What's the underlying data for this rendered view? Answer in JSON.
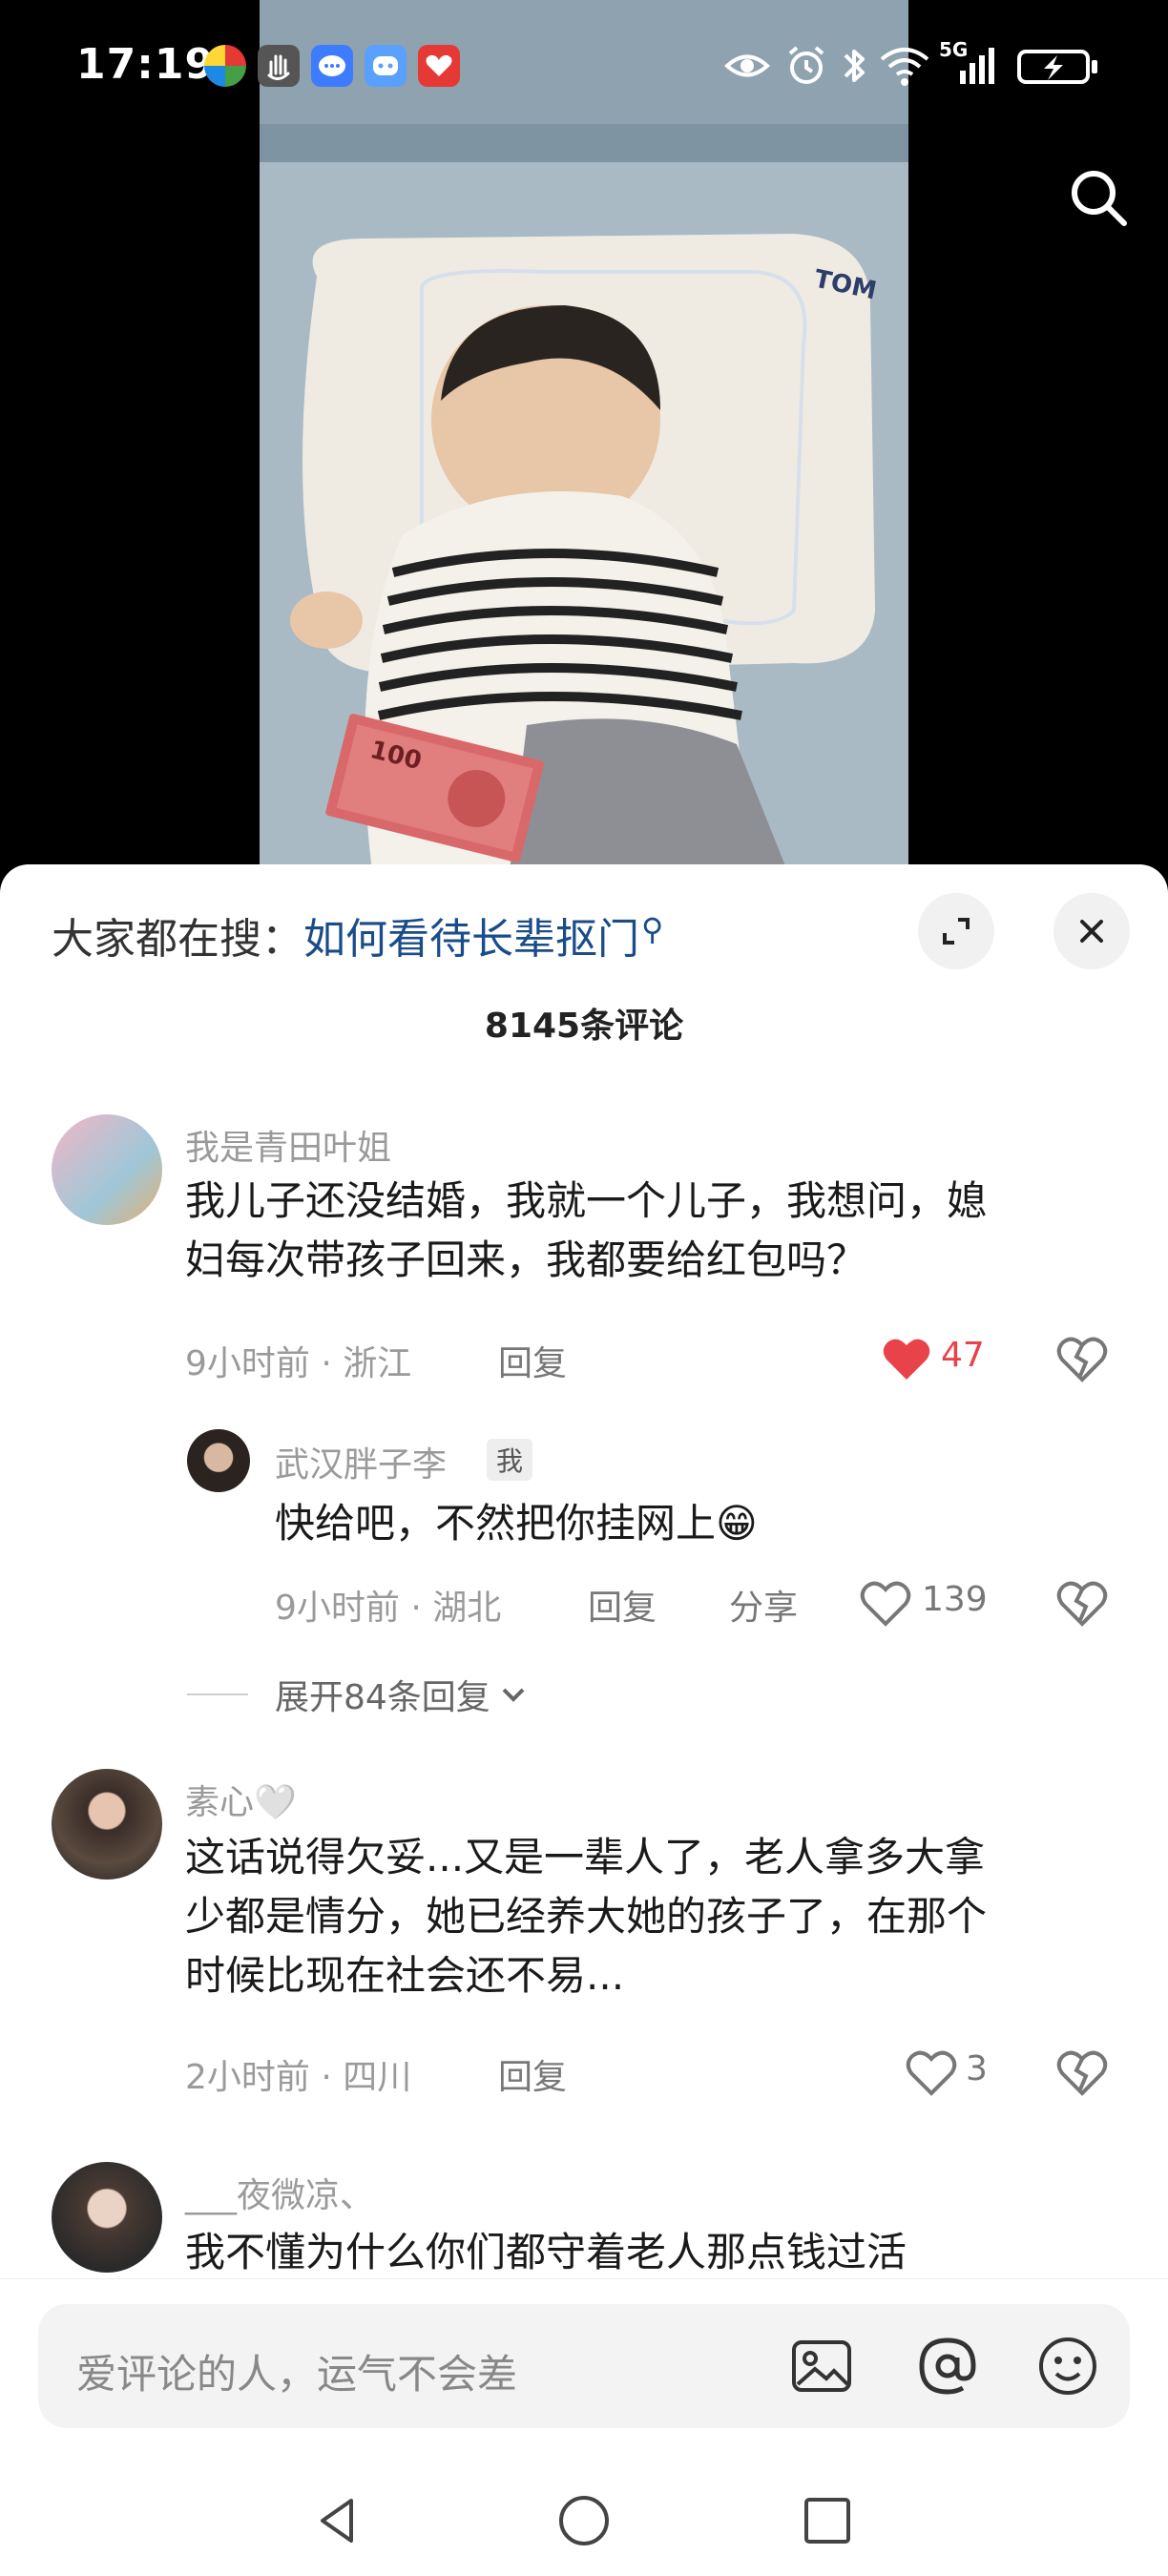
{
  "status_bar": {
    "time": "17:19",
    "network": "5G",
    "icons": [
      "eye-icon",
      "alarm-icon",
      "bluetooth-icon",
      "wifi-icon",
      "signal-icon",
      "battery-charging-icon"
    ]
  },
  "video": {
    "pillow_brand": "TOM",
    "banknote_value": "100"
  },
  "sheet": {
    "search_prefix": "大家都在搜：",
    "search_query": "如何看待长辈抠门",
    "comment_count": "8145条评论"
  },
  "comments": [
    {
      "username": "我是青田叶姐",
      "text_line1": "我儿子还没结婚，我就一个儿子，我想问，媳",
      "text_line2": "妇每次带孩子回来，我都要给红包吗？",
      "meta": "9小时前 · 浙江",
      "reply_label": "回复",
      "likes": "47",
      "liked": true,
      "reply": {
        "username": "武汉胖子李",
        "badge": "我",
        "text": "快给吧，不然把你挂网上😁",
        "meta": "9小时前 · 湖北",
        "reply_label": "回复",
        "share_label": "分享",
        "likes": "139"
      },
      "expand_label": "展开84条回复"
    },
    {
      "username": "素心🤍",
      "text_line1": "这话说得欠妥...又是一辈人了，老人拿多大拿",
      "text_line2": "少都是情分，她已经养大她的孩子了，在那个",
      "text_line3": "时候比现在社会还不易...",
      "meta": "2小时前 · 四川",
      "reply_label": "回复",
      "likes": "3"
    },
    {
      "username": "___夜微凉、",
      "text_line1": "我不懂为什么你们都守着老人那点钱过活"
    }
  ],
  "input": {
    "placeholder": "爱评论的人，运气不会差"
  },
  "colors": {
    "accent_link": "#1a4c8a",
    "like_red": "#e8424a",
    "muted": "#9a9a9a"
  }
}
